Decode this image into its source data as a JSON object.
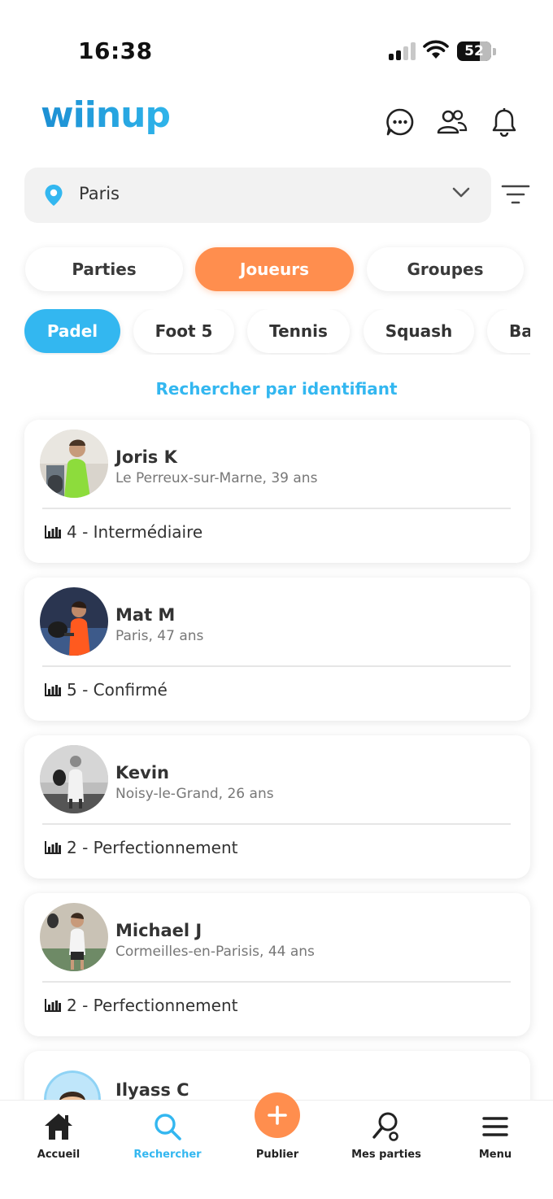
{
  "status_bar": {
    "time": "16:38",
    "battery": "52"
  },
  "header": {
    "logo_text": "wiinup",
    "icons": [
      "chat-icon",
      "friends-icon",
      "bell-icon"
    ]
  },
  "location": {
    "value": "Paris",
    "icon": "location-pin-icon"
  },
  "tabs": [
    {
      "label": "Parties",
      "active": false
    },
    {
      "label": "Joueurs",
      "active": true
    },
    {
      "label": "Groupes",
      "active": false
    }
  ],
  "sports": [
    {
      "label": "Padel",
      "active": true
    },
    {
      "label": "Foot 5",
      "active": false
    },
    {
      "label": "Tennis",
      "active": false
    },
    {
      "label": "Squash",
      "active": false
    },
    {
      "label": "Ba",
      "active": false
    }
  ],
  "search_by_id_label": "Rechercher par identifiant",
  "players": [
    {
      "name": "Joris K",
      "meta": "Le Perreux-sur-Marne, 39 ans",
      "level": "4 - Intermédiaire"
    },
    {
      "name": "Mat M",
      "meta": "Paris, 47 ans",
      "level": "5 - Confirmé"
    },
    {
      "name": "Kevin",
      "meta": "Noisy-le-Grand, 26 ans",
      "level": "2 - Perfectionnement"
    },
    {
      "name": "Michael J",
      "meta": "Cormeilles-en-Parisis, 44 ans",
      "level": "2 - Perfectionnement"
    },
    {
      "name": "Ilyass C",
      "meta": "",
      "level": ""
    }
  ],
  "bottom_nav": [
    {
      "label": "Accueil",
      "icon": "home-icon",
      "active": false
    },
    {
      "label": "Rechercher",
      "icon": "search-icon",
      "active": true
    },
    {
      "label": "Publier",
      "icon": "plus-icon",
      "active": false
    },
    {
      "label": "Mes parties",
      "icon": "racket-icon",
      "active": false
    },
    {
      "label": "Menu",
      "icon": "menu-icon",
      "active": false
    }
  ],
  "colors": {
    "accent_orange": "#ff8e4e",
    "accent_blue": "#33b7f0",
    "logo_blue": "#1c8fd3"
  }
}
